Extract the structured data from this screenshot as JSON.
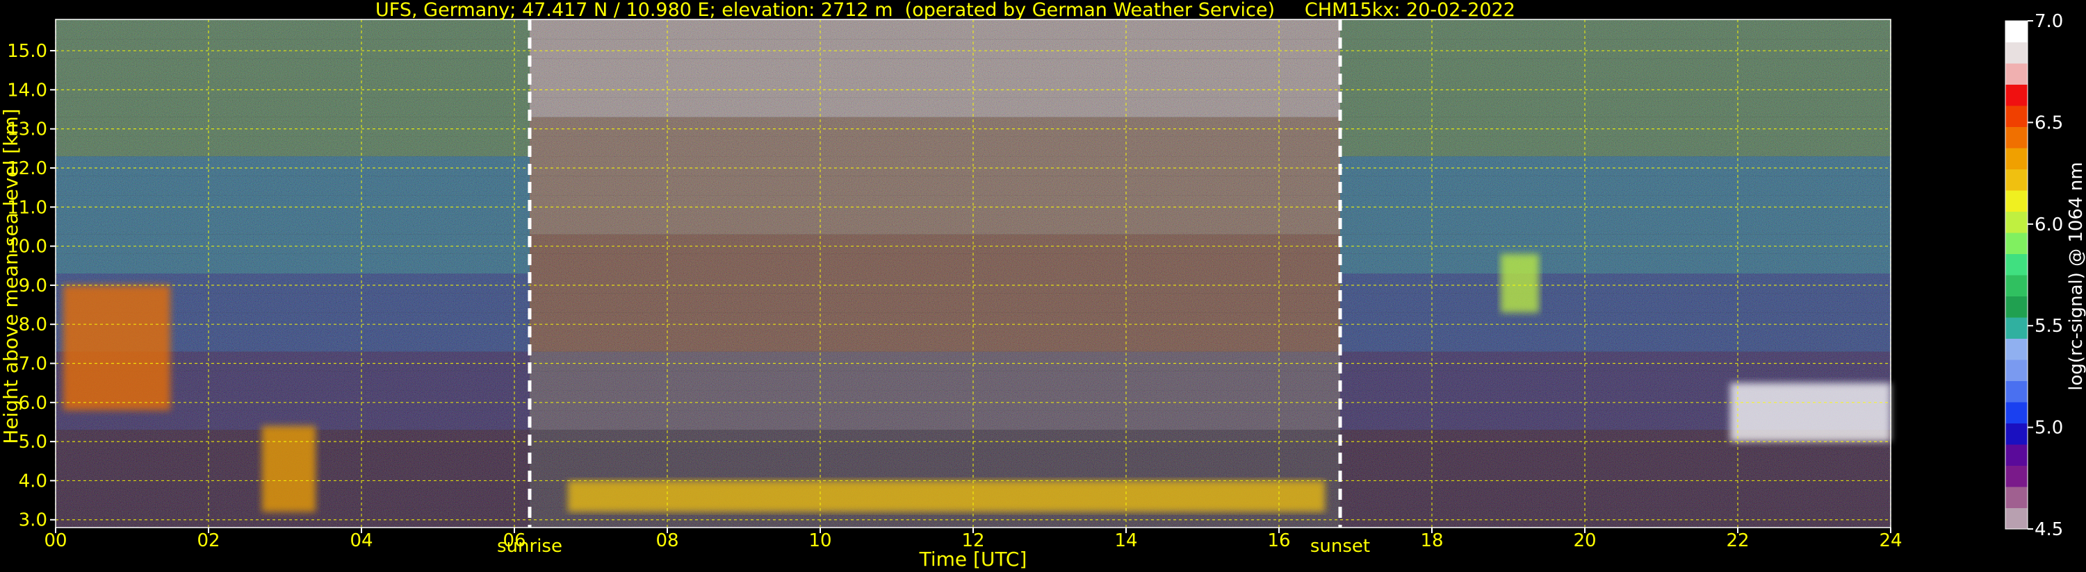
{
  "chart_data": {
    "type": "heatmap",
    "title": "UFS, Germany; 47.417 N / 10.980 E; elevation: 2712 m  (operated by German Weather Service)     CHM15kx: 20-02-2022",
    "xlabel": "Time [UTC]",
    "ylabel": "Height above mean sea level [km]",
    "xlim": [
      0,
      24
    ],
    "ylim": [
      2.8,
      15.8
    ],
    "x_ticks": [
      0,
      2,
      4,
      6,
      8,
      10,
      12,
      14,
      16,
      18,
      20,
      22,
      24
    ],
    "x_tick_labels": [
      "00",
      "02",
      "04",
      "06",
      "08",
      "10",
      "12",
      "14",
      "16",
      "18",
      "20",
      "22",
      "24"
    ],
    "y_ticks": [
      3.0,
      4.0,
      5.0,
      6.0,
      7.0,
      8.0,
      9.0,
      10.0,
      11.0,
      12.0,
      13.0,
      14.0,
      15.0
    ],
    "y_tick_labels": [
      "3.0",
      "4.0",
      "5.0",
      "6.0",
      "7.0",
      "8.0",
      "9.0",
      "10.0",
      "11.0",
      "12.0",
      "13.0",
      "14.0",
      "15.0"
    ],
    "grid": true,
    "grid_color": "#ffff00",
    "events": [
      {
        "label": "sunrise",
        "time": 6.2
      },
      {
        "label": "sunset",
        "time": 16.8
      }
    ],
    "colorbar": {
      "label": "log(rc-signal) @ 1064 nm",
      "range": [
        4.5,
        7.0
      ],
      "ticks": [
        4.5,
        5.0,
        5.5,
        6.0,
        6.5,
        7.0
      ],
      "tick_labels": [
        "4.5",
        "5.0",
        "5.5",
        "6.0",
        "6.5",
        "7.0"
      ],
      "colors": [
        "#b8a0b0",
        "#a06090",
        "#7a1a8a",
        "#5a0a9a",
        "#1a10c0",
        "#1a40f0",
        "#4a70f0",
        "#7a9af0",
        "#90b0f0",
        "#30b0a0",
        "#20a050",
        "#30c060",
        "#40e080",
        "#80f060",
        "#c0f040",
        "#f0f020",
        "#f0c010",
        "#f0a000",
        "#f07000",
        "#f04000",
        "#f01010",
        "#f0b0b0",
        "#e8e0e0",
        "#ffffff"
      ]
    },
    "features": [
      {
        "name": "cloud",
        "x": [
          0.1,
          1.5
        ],
        "y": [
          5.8,
          9.0
        ],
        "level": 6.4
      },
      {
        "name": "cloud",
        "x": [
          2.7,
          3.4
        ],
        "y": [
          3.2,
          5.4
        ],
        "level": 6.3
      },
      {
        "name": "boundary-layer",
        "x": [
          6.7,
          16.6
        ],
        "y": [
          3.2,
          4.0
        ],
        "level": 6.2
      },
      {
        "name": "cloud",
        "x": [
          18.9,
          19.4
        ],
        "y": [
          8.3,
          9.8
        ],
        "level": 6.0
      },
      {
        "name": "cloud",
        "x": [
          21.9,
          24.0
        ],
        "y": [
          5.0,
          6.5
        ],
        "level": 6.9
      }
    ]
  }
}
